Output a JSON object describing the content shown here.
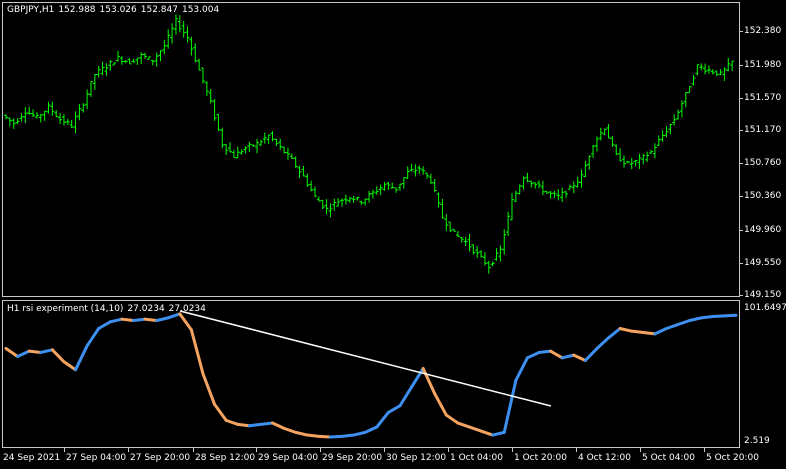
{
  "main_chart": {
    "symbol": "GBPJPY,H1",
    "ohlc": [
      "152.988",
      "153.026",
      "152.847",
      "153.004"
    ],
    "price_ticks": [
      "152.380",
      "151.980",
      "151.570",
      "151.170",
      "150.760",
      "150.360",
      "149.960",
      "149.550",
      "149.150"
    ],
    "candle_color": "#00ff00",
    "background": "#000000"
  },
  "indicator": {
    "label": "H1 rsi experiment (14,10)",
    "values": [
      "27.0234",
      "27.0234"
    ],
    "scale_max": "101.6497",
    "scale_min": "2.519",
    "rising_color": "#3d8ff0",
    "falling_color": "#f4a460",
    "trendline_color": "#ffffff"
  },
  "time_axis": {
    "labels": [
      "24 Sep 2021",
      "27 Sep 04:00",
      "27 Sep 20:00",
      "28 Sep 12:00",
      "29 Sep 04:00",
      "29 Sep 20:00",
      "30 Sep 12:00",
      "1 Oct 04:00",
      "1 Oct 20:00",
      "4 Oct 12:00",
      "5 Oct 04:00",
      "5 Oct 20:00"
    ]
  },
  "chart_data": {
    "type": "line",
    "title": "GBPJPY,H1",
    "ylim": [
      149.15,
      152.6
    ],
    "series": [
      {
        "values": [
          151.35,
          151.25,
          151.4,
          151.32,
          151.45,
          151.3,
          151.22,
          151.5,
          151.85,
          151.95,
          152.05,
          152.0,
          152.08,
          152.02,
          152.2,
          152.5,
          152.3,
          151.9,
          151.5,
          151.0,
          150.85,
          150.95,
          151.0,
          151.1,
          150.95,
          150.8,
          150.6,
          150.35,
          150.2,
          150.3,
          150.35,
          150.3,
          150.4,
          150.5,
          150.45,
          150.65,
          150.7,
          150.55,
          150.1,
          149.9,
          149.8,
          149.65,
          149.5,
          149.7,
          150.3,
          150.6,
          150.5,
          150.4,
          150.35,
          150.45,
          150.6,
          151.0,
          151.2,
          150.85,
          150.75,
          150.8,
          150.9,
          151.1,
          151.3,
          151.6,
          151.95,
          151.9,
          151.85,
          152.0
        ],
        "rsi": [
          72.0,
          66.0,
          70.0,
          69.0,
          71.0,
          62.0,
          56.0,
          74.0,
          87.0,
          92.0,
          94.0,
          93.0,
          94.0,
          93.0,
          95.0,
          98.0,
          86.0,
          53.0,
          30.0,
          18.0,
          15.0,
          14.0,
          15.0,
          16.0,
          12.0,
          9.0,
          7.0,
          6.0,
          5.5,
          6.0,
          7.0,
          9.0,
          13.0,
          24.0,
          29.0,
          43.0,
          57.0,
          38.0,
          22.0,
          16.0,
          13.0,
          10.0,
          7.0,
          9.0,
          48.0,
          65.0,
          69.0,
          70.0,
          65.0,
          67.0,
          63.0,
          72.0,
          80.0,
          87.0,
          85.0,
          84.0,
          83.0,
          87.0,
          90.0,
          93.0,
          95.0,
          96.0,
          96.5,
          97.0
        ]
      }
    ]
  }
}
